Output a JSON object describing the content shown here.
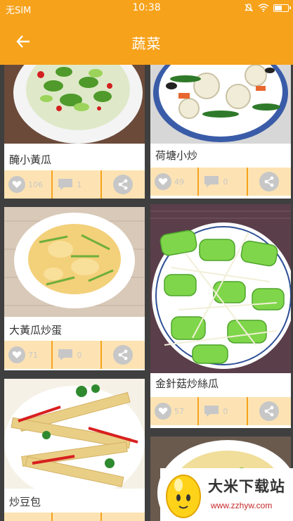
{
  "status_bar": {
    "carrier": "无SIM",
    "time": "10:38",
    "battery_level": 0.6
  },
  "app_bar": {
    "title": "蔬菜",
    "back_icon": "arrow-left-icon"
  },
  "colors": {
    "accent": "#f7a21b",
    "action_bg": "#fde3b3",
    "icon_gray": "#c7c7c7"
  },
  "recipes": [
    {
      "name": "醃小黃瓜",
      "likes": "106",
      "comments": "1"
    },
    {
      "name": "荷塘小炒",
      "likes": "49",
      "comments": "0"
    },
    {
      "name": "大黃瓜炒蛋",
      "likes": "71",
      "comments": "0"
    },
    {
      "name": "金針菇炒絲瓜",
      "likes": "57",
      "comments": "0"
    },
    {
      "name": "炒豆包",
      "likes": "",
      "comments": ""
    }
  ],
  "watermark": {
    "brand": "大米下载站",
    "url": "www.zzhyw.com"
  }
}
